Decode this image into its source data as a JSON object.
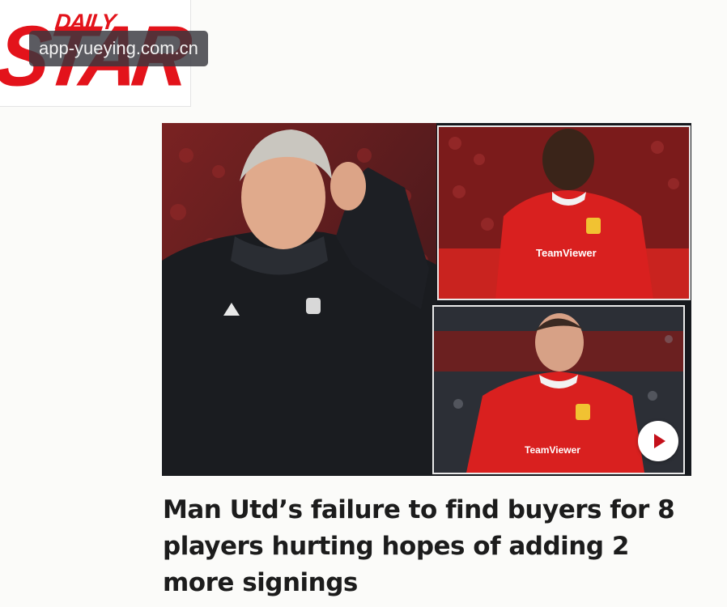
{
  "masthead": {
    "logo_daily": "DAILY",
    "logo_star": "STAR",
    "brand_color": "#e3131b"
  },
  "watermark": {
    "text": "app-yueying.com.cn"
  },
  "hero": {
    "kit_colors": {
      "shirt": "#d9201f",
      "jacket": "#1a1c20",
      "background": "#16191e"
    },
    "player_top": {
      "shirt_sponsor": "TeamViewer"
    },
    "player_bottom": {
      "shirt_sponsor": "TeamViewer"
    },
    "play_icon": "play-icon"
  },
  "article": {
    "headline": "Man Utd’s failure to find buyers for 8 players hurting hopes of adding 2 more signings"
  }
}
